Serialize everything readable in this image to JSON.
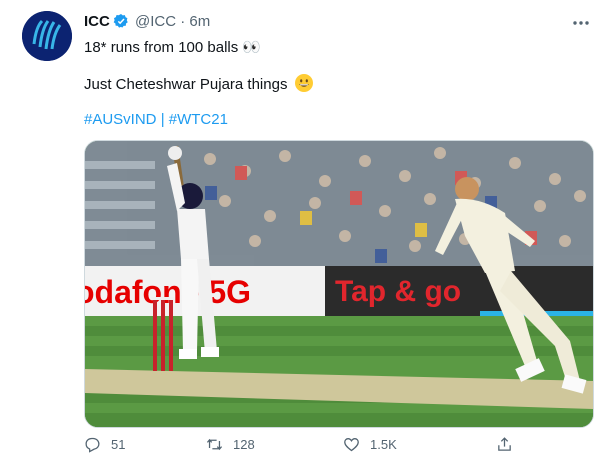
{
  "account": {
    "name": "ICC",
    "handle": "@ICC",
    "separator": "·",
    "time": "6m",
    "avatar_icon": "icc-logo-icon",
    "verified_color": "#1d9bf0"
  },
  "tweet": {
    "line1": "18* runs from 100 balls 👀",
    "line2": "Just Cheteshwar Pujara things",
    "line2_emoji": "grinning-face-emoji",
    "hashtag1": "#AUSvIND",
    "hashtag_separator": " | ",
    "hashtag2": "#WTC21"
  },
  "media": {
    "board_left_text": "odafone 5G",
    "board_right_text": "Tap & go"
  },
  "actions": {
    "replies": "51",
    "retweets": "128",
    "likes": "1.5K"
  },
  "colors": {
    "link": "#1d9bf0",
    "muted": "#536471",
    "accent_red": "#e1262d"
  }
}
